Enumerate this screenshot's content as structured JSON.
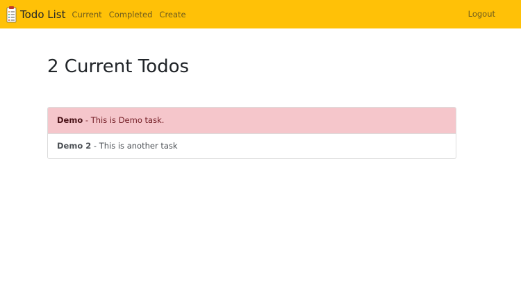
{
  "navbar": {
    "brand": "Todo List",
    "brand_icon": "checklist-icon",
    "links": [
      "Current",
      "Completed",
      "Create"
    ],
    "logout": "Logout",
    "accent_color": "#ffc107"
  },
  "main": {
    "title": "2 Current Todos",
    "todos": [
      {
        "name": "Demo",
        "separator": " - ",
        "description": "This is Demo task.",
        "style": "danger",
        "highlight_color": "#f5c6cb"
      },
      {
        "name": "Demo 2",
        "separator": " - ",
        "description": "This is another task",
        "style": "default"
      }
    ]
  }
}
